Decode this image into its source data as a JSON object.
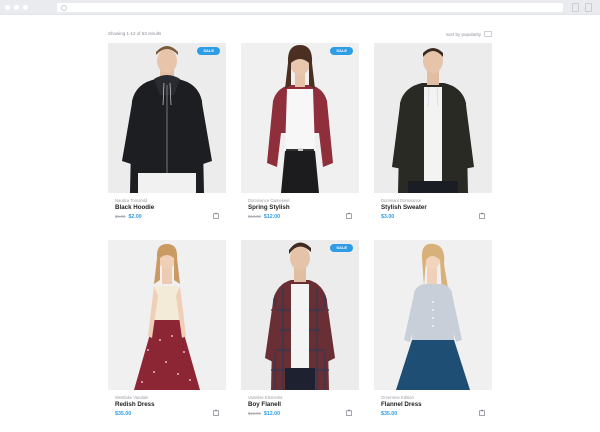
{
  "toolbar": {
    "showing": "Showing 1-12 of 53 results",
    "sort": "Sort by popularity"
  },
  "products": [
    {
      "brand": "Nautica Tomahild",
      "name": "Black Hoodie",
      "old_price": "$5.00",
      "price": "$2.00",
      "badge": "SALE",
      "photo": "person-black-hoodie"
    },
    {
      "brand": "Dominance Gamekeel",
      "name": "Spring Stylish",
      "old_price": "$19.00",
      "price": "$12.00",
      "badge": "SALE",
      "photo": "person-maroon-cardigan"
    },
    {
      "brand": "Dominant Dominance",
      "name": "Stylish Sweater",
      "old_price": "",
      "price": "$3.00",
      "badge": "",
      "photo": "person-dark-hoodie"
    },
    {
      "brand": "Westlake Vandals",
      "name": "Redish Dress",
      "old_price": "",
      "price": "$35.00",
      "badge": "",
      "photo": "person-red-skirt"
    },
    {
      "brand": "Vanelise Elements",
      "name": "Boy Flanell",
      "old_price": "$19.00",
      "price": "$12.00",
      "badge": "SALE",
      "photo": "person-plaid-shirt"
    },
    {
      "brand": "Greentree Edition",
      "name": "Flannel Dress",
      "old_price": "",
      "price": "$35.00",
      "badge": "",
      "photo": "person-blue-skirt"
    }
  ],
  "colors": {
    "accent": "#2e9de7",
    "page_background": "#ffffff",
    "card_photo_background": "#ececed"
  }
}
